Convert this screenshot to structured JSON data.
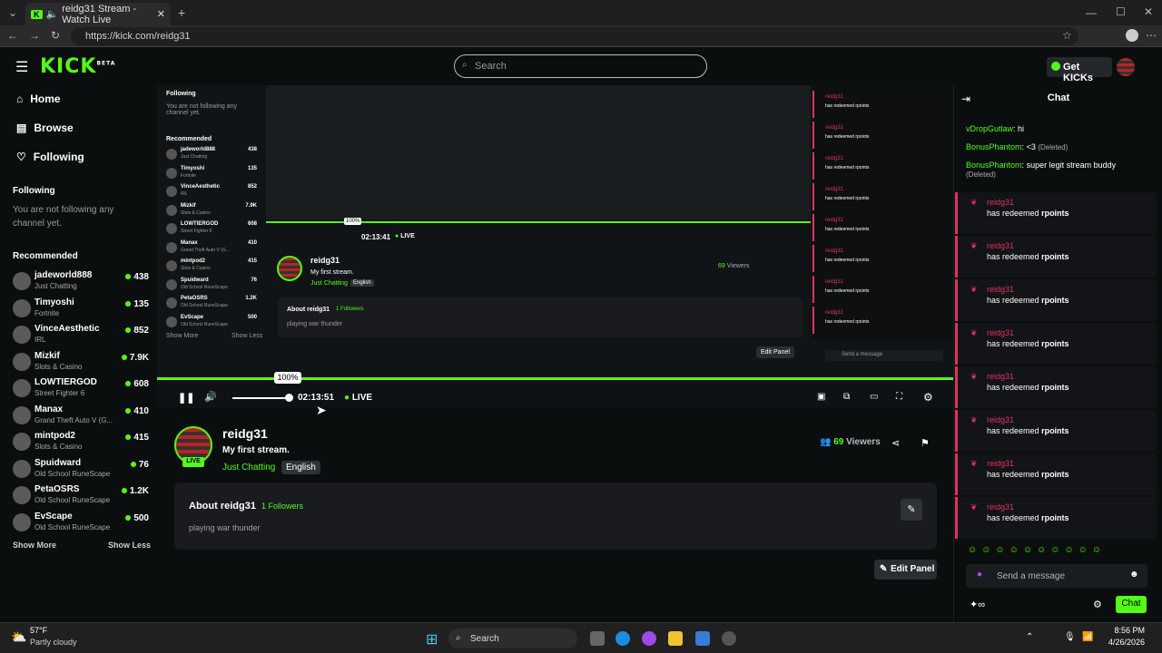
{
  "browser": {
    "tab_title": "reidg31 Stream - Watch Live",
    "url": "https://kick.com/reidg31"
  },
  "header": {
    "logo": "KICK",
    "logo_beta": "BETA",
    "search_placeholder": "Search",
    "get_kicks": "Get KICKs"
  },
  "sidebar": {
    "nav": [
      {
        "label": "Home",
        "icon": "home-icon"
      },
      {
        "label": "Browse",
        "icon": "browse-icon"
      },
      {
        "label": "Following",
        "icon": "heart-icon"
      }
    ],
    "following_title": "Following",
    "following_empty": "You are not following any channel yet.",
    "recommended_title": "Recommended",
    "recommended": [
      {
        "name": "jadeworld888",
        "category": "Just Chatting",
        "viewers": "438"
      },
      {
        "name": "Timyoshi",
        "category": "Fortnite",
        "viewers": "135"
      },
      {
        "name": "VinceAesthetic",
        "category": "IRL",
        "viewers": "852"
      },
      {
        "name": "Mizkif",
        "category": "Slots & Casino",
        "viewers": "7.9K"
      },
      {
        "name": "LOWTIERGOD",
        "category": "Street Fighter 6",
        "viewers": "608"
      },
      {
        "name": "Manax",
        "category": "Grand Theft Auto V (G...",
        "viewers": "410"
      },
      {
        "name": "mintpod2",
        "category": "Slots & Casino",
        "viewers": "415"
      },
      {
        "name": "Spuidward",
        "category": "Old School RuneScape",
        "viewers": "76"
      },
      {
        "name": "PetaOSRS",
        "category": "Old School RuneScape",
        "viewers": "1.2K"
      },
      {
        "name": "EvScape",
        "category": "Old School RuneScape",
        "viewers": "500"
      }
    ],
    "show_more": "Show More",
    "show_less": "Show Less"
  },
  "player": {
    "volume_tooltip": "100%",
    "time": "02:13:51",
    "live": "LIVE",
    "volume_level": 1.0
  },
  "inner_player": {
    "time": "02:13:41",
    "live": "LIVE",
    "volume_tooltip": "100%"
  },
  "channel": {
    "name": "reidg31",
    "title": "My first stream.",
    "category": "Just Chatting",
    "language": "English",
    "live_badge": "LIVE",
    "viewers": "69",
    "viewers_label": "Viewers",
    "about_title": "About reidg31",
    "followers": "1 Followers",
    "bio": "playing war thunder",
    "edit_panel": "Edit Panel"
  },
  "chat": {
    "title": "Chat",
    "top_messages": [
      {
        "user": "vDropGutlaw",
        "text": "hi",
        "suffix": ""
      },
      {
        "user": "BonusPhantom",
        "text": "<3",
        "suffix": "(Deleted)"
      },
      {
        "user": "BonusPhantom",
        "text": "super legit stream buddy",
        "suffix": "(Deleted)"
      }
    ],
    "redeem_user": "reidg31",
    "redeem_text": "has redeemed",
    "redeem_item": "rpoints",
    "redeem_count": 8,
    "send_placeholder": "Send a message",
    "chat_button": "Chat"
  },
  "taskbar": {
    "weather_temp": "57°F",
    "weather_desc": "Partly cloudy",
    "search": "Search",
    "time": "8:56 PM",
    "date": "4/26/2026"
  },
  "colors": {
    "accent": "#53fc18",
    "chat_user": "#e0335e",
    "background": "#0b0e0f"
  }
}
